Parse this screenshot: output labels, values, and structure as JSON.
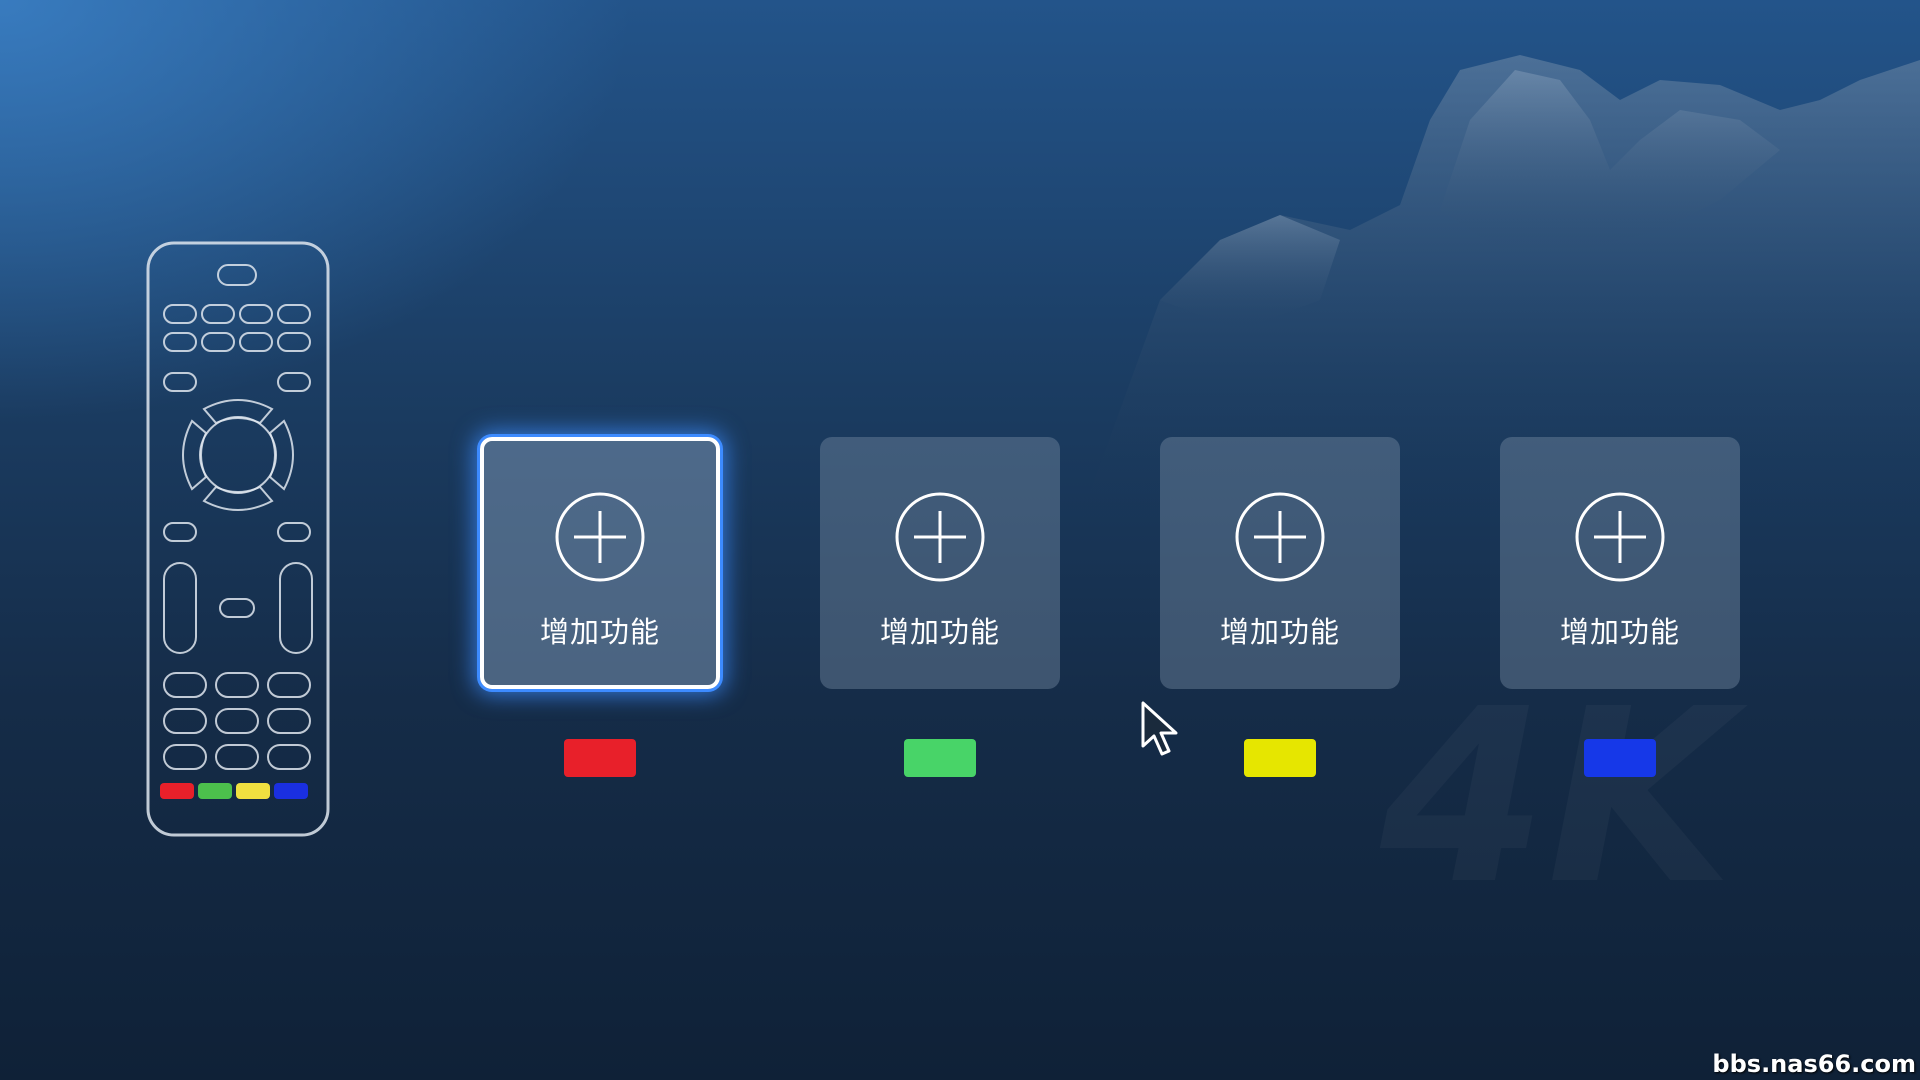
{
  "remote": {
    "icon": "remote-control-icon",
    "color_keys": [
      "#e8202a",
      "#4cc04c",
      "#f0e040",
      "#1a2fe0"
    ]
  },
  "cards": [
    {
      "label": "增加功能",
      "icon": "plus-circle-icon",
      "color_key": "#e8202a",
      "color_name": "red",
      "focused": true
    },
    {
      "label": "增加功能",
      "icon": "plus-circle-icon",
      "color_key": "#48d468",
      "color_name": "green",
      "focused": false
    },
    {
      "label": "增加功能",
      "icon": "plus-circle-icon",
      "color_key": "#e6e600",
      "color_name": "yellow",
      "focused": false
    },
    {
      "label": "增加功能",
      "icon": "plus-circle-icon",
      "color_key": "#1638e8",
      "color_name": "blue",
      "focused": false
    }
  ],
  "watermark": {
    "site": "bbs.nas66.com",
    "background_text": "4K"
  },
  "colors": {
    "focus_glow": "#3d8bff"
  }
}
